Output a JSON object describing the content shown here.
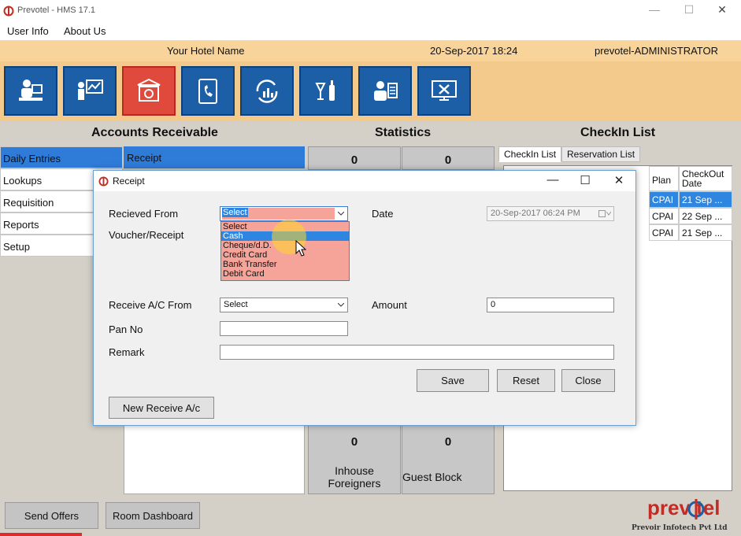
{
  "window": {
    "title": "Prevotel - HMS 17.1"
  },
  "menu": [
    "User Info",
    "About Us"
  ],
  "header": {
    "hotel": "Your Hotel Name",
    "datetime": "20-Sep-2017 18:24",
    "user": "prevotel-ADMINISTRATOR"
  },
  "toolbar": [
    {
      "icon": "front-desk-icon"
    },
    {
      "icon": "presentation-icon"
    },
    {
      "icon": "accounts-icon",
      "active": true
    },
    {
      "icon": "phone-book-icon"
    },
    {
      "icon": "sync-chart-icon"
    },
    {
      "icon": "restaurant-bar-icon"
    },
    {
      "icon": "staff-icon"
    },
    {
      "icon": "settings-monitor-icon"
    }
  ],
  "sections": {
    "accounts": "Accounts Receivable",
    "statistics": "Statistics",
    "checkin": "CheckIn List"
  },
  "nav": [
    "Daily Entries",
    "Lookups",
    "Requisition",
    "Reports",
    "Setup"
  ],
  "receipt_tab": "Receipt",
  "stats": {
    "top_left": "0",
    "top_right": "0",
    "bottom_left": {
      "value": "0",
      "label": "Inhouse Foreigners"
    },
    "bottom_right": {
      "value": "0",
      "label": "Guest Block"
    }
  },
  "checkin": {
    "tabs": [
      "CheckIn List",
      "Reservation List"
    ],
    "columns": [
      "Plan",
      "CheckOut Date"
    ],
    "rows": [
      {
        "plan": "CPAI",
        "checkout": "21 Sep ...",
        "selected": true
      },
      {
        "plan": "CPAI",
        "checkout": "22 Sep ...",
        "selected": false
      },
      {
        "plan": "CPAI",
        "checkout": "21 Sep ...",
        "selected": false
      }
    ]
  },
  "bottom": {
    "send_offers": "Send Offers",
    "room_dashboard": "Room Dashboard",
    "brand_word": "prev tel",
    "brand_tag": "Prevoir Infotech Pvt Ltd"
  },
  "dialog": {
    "title": "Receipt",
    "received_from": {
      "label": "Recieved From",
      "value": "Select",
      "options": [
        "Select",
        "Cash",
        "Cheque/d.D.",
        "Credit Card",
        "Bank Transfer",
        "Debit Card"
      ],
      "highlighted": "Cash"
    },
    "voucher_label": "Voucher/Receipt",
    "date": {
      "label": "Date",
      "value": "20-Sep-2017 06:24 PM"
    },
    "receive_ac": {
      "label": "Receive A/C From",
      "value": "Select"
    },
    "amount": {
      "label": "Amount",
      "value": "0"
    },
    "pan": {
      "label": "Pan No",
      "value": ""
    },
    "remark": {
      "label": "Remark",
      "value": ""
    },
    "buttons": {
      "save": "Save",
      "reset": "Reset",
      "close": "Close",
      "new_receive": "New Receive A/c"
    }
  },
  "colors": {
    "toolbar_bg": "#f4c98c",
    "header_bg": "#f8d49a",
    "tile_blue": "#1c5fa6",
    "tile_active": "#e04a3c",
    "selection_blue": "#2f7bd8",
    "dropdown_bg": "#f6a49a",
    "brand_red": "#c32b24"
  }
}
